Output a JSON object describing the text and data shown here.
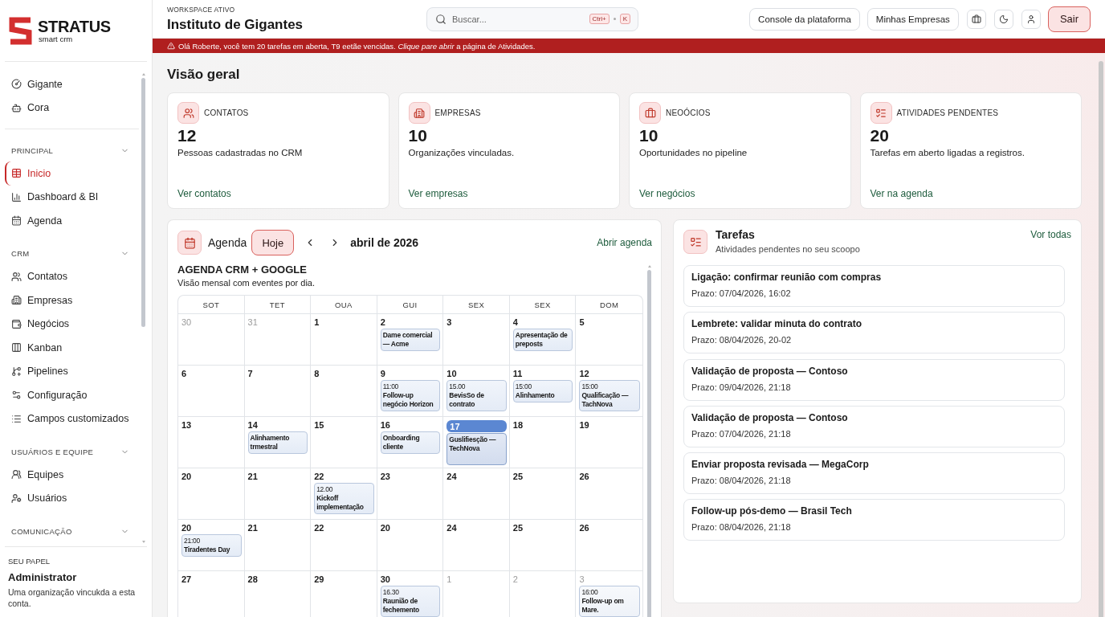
{
  "sidebar": {
    "logo": {
      "name": "STRATUS",
      "tagline": "smart crm"
    },
    "shortcuts": [
      {
        "label": "Gigante",
        "selected": false
      },
      {
        "label": "Cora",
        "selected": false
      }
    ],
    "sections": [
      {
        "title": "PRINCIPAL",
        "expanded": true,
        "items": [
          {
            "label": "Inicio",
            "selected": true
          },
          {
            "label": "Dashboard & BI",
            "selected": false
          },
          {
            "label": "Agenda",
            "selected": false
          }
        ]
      },
      {
        "title": "CRM",
        "expanded": true,
        "items": [
          {
            "label": "Contatos",
            "selected": false
          },
          {
            "label": "Empresas",
            "selected": false
          },
          {
            "label": "Negócios",
            "selected": false
          },
          {
            "label": "Kanban",
            "selected": false
          },
          {
            "label": "Pipelines",
            "selected": false
          },
          {
            "label": "Configuração",
            "selected": false
          },
          {
            "label": "Campos customizados",
            "selected": false
          }
        ]
      },
      {
        "title": "USUÁRIOS E EQUIPE",
        "expanded": true,
        "items": [
          {
            "label": "Equipes",
            "selected": false
          },
          {
            "label": "Usuários",
            "selected": false
          }
        ]
      },
      {
        "title": "COMUNICAÇÃO",
        "expanded": true
      }
    ],
    "role": {
      "label": "SEU PAPEL",
      "name": "Administrator",
      "description": "Uma organização vincukda a esta conta."
    }
  },
  "header": {
    "workspace_label": "WORKSPACE ATIVO",
    "workspace_name": "Instituto de Gigantes",
    "search": {
      "placeholder": "Buscar...",
      "shortcut": [
        "Ctrl+",
        "K"
      ]
    },
    "buttons": [
      "Console da plataforma",
      "Minhas Empresas"
    ],
    "logout": "Sair"
  },
  "alert": {
    "text": "Olá Roberte, você tem 20 tarefas em aberta, T9 eetãe vencidas. *Clique pare abrir* a página de Atividades."
  },
  "page_title": "Visão geral",
  "stats": [
    {
      "label": "CONTATOS",
      "value": "12",
      "description": "Pessoas cadastradas no CRM",
      "link": "Ver contatos"
    },
    {
      "label": "EMPRESAS",
      "value": "10",
      "description": "Organizações vinculadas.",
      "link": "Ver empresas"
    },
    {
      "label": "NEOÓCIOS",
      "value": "10",
      "description": "Oportunidades no pipeline",
      "link": "Ver negócios"
    },
    {
      "label": "ATIVIDADES PENDENTES",
      "value": "20",
      "description": "Tarefas em aberto ligadas a registros.",
      "link": "Ver na agenda"
    }
  ],
  "agenda": {
    "title": "Agenda",
    "today_button": "Hoje",
    "month": "abril de 2026",
    "open_link": "Abrir agenda",
    "calendar_title": "AGENDA CRM + GOOGLE",
    "calendar_subtitle": "Visão mensal com eventes por dia.",
    "weekdays": [
      "SOT",
      "TET",
      "OUA",
      "GUI",
      "SEX",
      "SEX",
      "DOM"
    ],
    "weeks": [
      [
        {
          "day": "30",
          "outside": true,
          "today": false
        },
        {
          "day": "31",
          "outside": true,
          "today": false
        },
        {
          "day": "1",
          "outside": false,
          "today": false
        },
        {
          "day": "2",
          "outside": false,
          "today": false,
          "events": [
            {
              "title": "Dame comercial — Acme"
            }
          ]
        },
        {
          "day": "3",
          "outside": false,
          "today": false
        },
        {
          "day": "4",
          "outside": false,
          "today": false,
          "events": [
            {
              "title": "Apresentação de preposts"
            }
          ]
        },
        {
          "day": "5",
          "outside": false,
          "today": false
        }
      ],
      [
        {
          "day": "6",
          "outside": false,
          "today": false
        },
        {
          "day": "7",
          "outside": false,
          "today": false
        },
        {
          "day": "8",
          "outside": false,
          "today": false
        },
        {
          "day": "9",
          "outside": false,
          "today": false,
          "events": [
            {
              "time": "11:00",
              "title": "Follow-up negócio Horizon"
            }
          ]
        },
        {
          "day": "10",
          "outside": false,
          "today": false,
          "events": [
            {
              "time": "15.00",
              "title": "BevisSo de contrato"
            }
          ]
        },
        {
          "day": "11",
          "outside": false,
          "today": false,
          "events": [
            {
              "time": "15:00",
              "title": "Alinhamento"
            }
          ]
        },
        {
          "day": "12",
          "outside": false,
          "today": false,
          "events": [
            {
              "time": "15:00",
              "title": "Qualificação — TachNova"
            }
          ]
        }
      ],
      [
        {
          "day": "13",
          "outside": false,
          "today": false
        },
        {
          "day": "14",
          "outside": false,
          "today": false,
          "events": [
            {
              "title": "Alinhamento trmestral"
            }
          ]
        },
        {
          "day": "15",
          "outside": false,
          "today": false
        },
        {
          "day": "16",
          "outside": false,
          "today": false,
          "events": [
            {
              "title": "Onboarding cliente"
            }
          ]
        },
        {
          "day": "17",
          "outside": false,
          "today": true,
          "events": [
            {
              "title": "Guslifiesção — TechNova"
            }
          ]
        },
        {
          "day": "18",
          "outside": false,
          "today": false
        },
        {
          "day": "19",
          "outside": false,
          "today": false
        }
      ],
      [
        {
          "day": "20",
          "outside": false,
          "today": false
        },
        {
          "day": "21",
          "outside": false,
          "today": false
        },
        {
          "day": "22",
          "outside": false,
          "today": false,
          "events": [
            {
              "time": "12.00",
              "title": "Kickoff implementação"
            }
          ]
        },
        {
          "day": "23",
          "outside": false,
          "today": false
        },
        {
          "day": "24",
          "outside": false,
          "today": false
        },
        {
          "day": "25",
          "outside": false,
          "today": false
        },
        {
          "day": "26",
          "outside": false,
          "today": false
        }
      ],
      [
        {
          "day": "20",
          "outside": false,
          "today": false,
          "events": [
            {
              "time": "21:00",
              "title": "Tiradentes Day"
            }
          ]
        },
        {
          "day": "21",
          "outside": false,
          "today": false
        },
        {
          "day": "22",
          "outside": false,
          "today": false
        },
        {
          "day": "20",
          "outside": false,
          "today": false
        },
        {
          "day": "24",
          "outside": false,
          "today": false
        },
        {
          "day": "25",
          "outside": false,
          "today": false
        },
        {
          "day": "26",
          "outside": false,
          "today": false
        }
      ],
      [
        {
          "day": "27",
          "outside": false,
          "today": false
        },
        {
          "day": "28",
          "outside": false,
          "today": false
        },
        {
          "day": "29",
          "outside": false,
          "today": false
        },
        {
          "day": "30",
          "outside": false,
          "today": false,
          "events": [
            {
              "time": "16.30",
              "title": "Raunião de fechemento"
            }
          ]
        },
        {
          "day": "1",
          "outside": true,
          "today": false
        },
        {
          "day": "2",
          "outside": true,
          "today": false
        },
        {
          "day": "3",
          "outside": true,
          "today": false,
          "events": [
            {
              "time": "16:00",
              "title": "Follow-up om Mare."
            }
          ]
        }
      ]
    ]
  },
  "tasks": {
    "title": "Tarefas",
    "subtitle": "Atividades pendentes no seu scoopo",
    "view_all": "Vor todas",
    "items": [
      {
        "title": "Ligação: confirmar reunião com compras",
        "due": "Prazo: 07/04/2026, 16:02"
      },
      {
        "title": "Lembrete: validar minuta do contrato",
        "due": "Prazo: 08/04/2026, 20-02"
      },
      {
        "title": "Validação de proposta — Contoso",
        "due": "Prazo: 09/04/2026, 21:18"
      },
      {
        "title": "Validação de proposta — Contoso",
        "due": "Prazo: 07/04/2026, 21:18"
      },
      {
        "title": "Enviar proposta revisada — MegaCorp",
        "due": "Prazo: 08/04/2026, 21:18"
      },
      {
        "title": "Follow-up pós-demo — Brasil Tech",
        "due": "Prazo: 08/04/2026, 21:18"
      }
    ]
  }
}
